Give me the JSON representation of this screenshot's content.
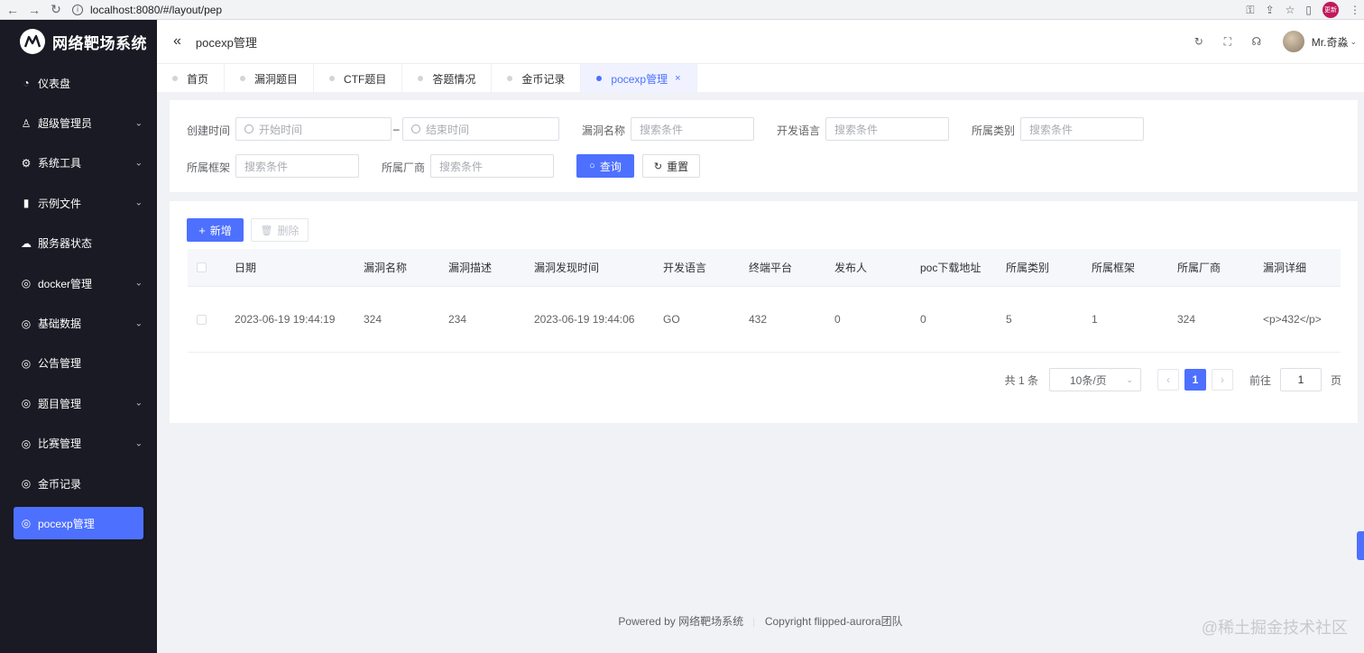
{
  "browser": {
    "url": "localhost:8080/#/layout/pep",
    "profile_label": "更新"
  },
  "app": {
    "title": "网络靶场系统"
  },
  "sidebar": {
    "items": [
      {
        "label": "仪表盘",
        "icon": "dashboard-icon",
        "expandable": false
      },
      {
        "label": "超级管理员",
        "icon": "user-icon",
        "expandable": true
      },
      {
        "label": "系统工具",
        "icon": "gear-icon",
        "expandable": true
      },
      {
        "label": "示例文件",
        "icon": "files-icon",
        "expandable": true
      },
      {
        "label": "服务器状态",
        "icon": "cloud-icon",
        "expandable": false
      },
      {
        "label": "docker管理",
        "icon": "compass-icon",
        "expandable": true
      },
      {
        "label": "基础数据",
        "icon": "compass-icon",
        "expandable": true
      },
      {
        "label": "公告管理",
        "icon": "compass-icon",
        "expandable": false
      },
      {
        "label": "题目管理",
        "icon": "compass-icon",
        "expandable": true
      },
      {
        "label": "比赛管理",
        "icon": "compass-icon",
        "expandable": true
      },
      {
        "label": "金币记录",
        "icon": "compass-icon",
        "expandable": false
      },
      {
        "label": "pocexp管理",
        "icon": "compass-icon",
        "expandable": false,
        "active": true
      }
    ]
  },
  "header": {
    "title": "pocexp管理",
    "username": "Mr.奇淼"
  },
  "tabs": [
    {
      "label": "首页"
    },
    {
      "label": "漏洞题目"
    },
    {
      "label": "CTF题目"
    },
    {
      "label": "答题情况"
    },
    {
      "label": "金币记录"
    },
    {
      "label": "pocexp管理",
      "active": true,
      "close": "×"
    }
  ],
  "search": {
    "created_label": "创建时间",
    "start_placeholder": "开始时间",
    "range_sep": "–",
    "end_placeholder": "结束时间",
    "vuln_name_label": "漏洞名称",
    "dev_lang_label": "开发语言",
    "category_label": "所属类别",
    "framework_label": "所属框架",
    "vendor_label": "所属厂商",
    "placeholder": "搜索条件",
    "query_button": "查询",
    "reset_button": "重置"
  },
  "toolbar": {
    "add_button": "新增",
    "delete_button": "删除"
  },
  "table": {
    "columns": [
      "日期",
      "漏洞名称",
      "漏洞描述",
      "漏洞发现时间",
      "开发语言",
      "终端平台",
      "发布人",
      "poc下载地址",
      "所属类别",
      "所属框架",
      "所属厂商",
      "漏洞详细"
    ],
    "rows": [
      [
        "2023-06-19 19:44:19",
        "324",
        "234",
        "2023-06-19 19:44:06",
        "GO",
        "432",
        "0",
        "0",
        "5",
        "1",
        "324",
        "<p>432</p>"
      ]
    ]
  },
  "pagination": {
    "total_text": "共 1 条",
    "page_size": "10条/页",
    "current_page": "1",
    "goto_label": "前往",
    "goto_value": "1",
    "page_suffix": "页"
  },
  "footer": {
    "powered": "Powered by",
    "powered_name": "网络靶场系统",
    "copyright": "Copyright",
    "copyright_name": "flipped-aurora团队"
  },
  "watermark": "@稀土掘金技术社区",
  "colors": {
    "accent": "#4d70ff",
    "sidebar_bg": "#191a23"
  }
}
